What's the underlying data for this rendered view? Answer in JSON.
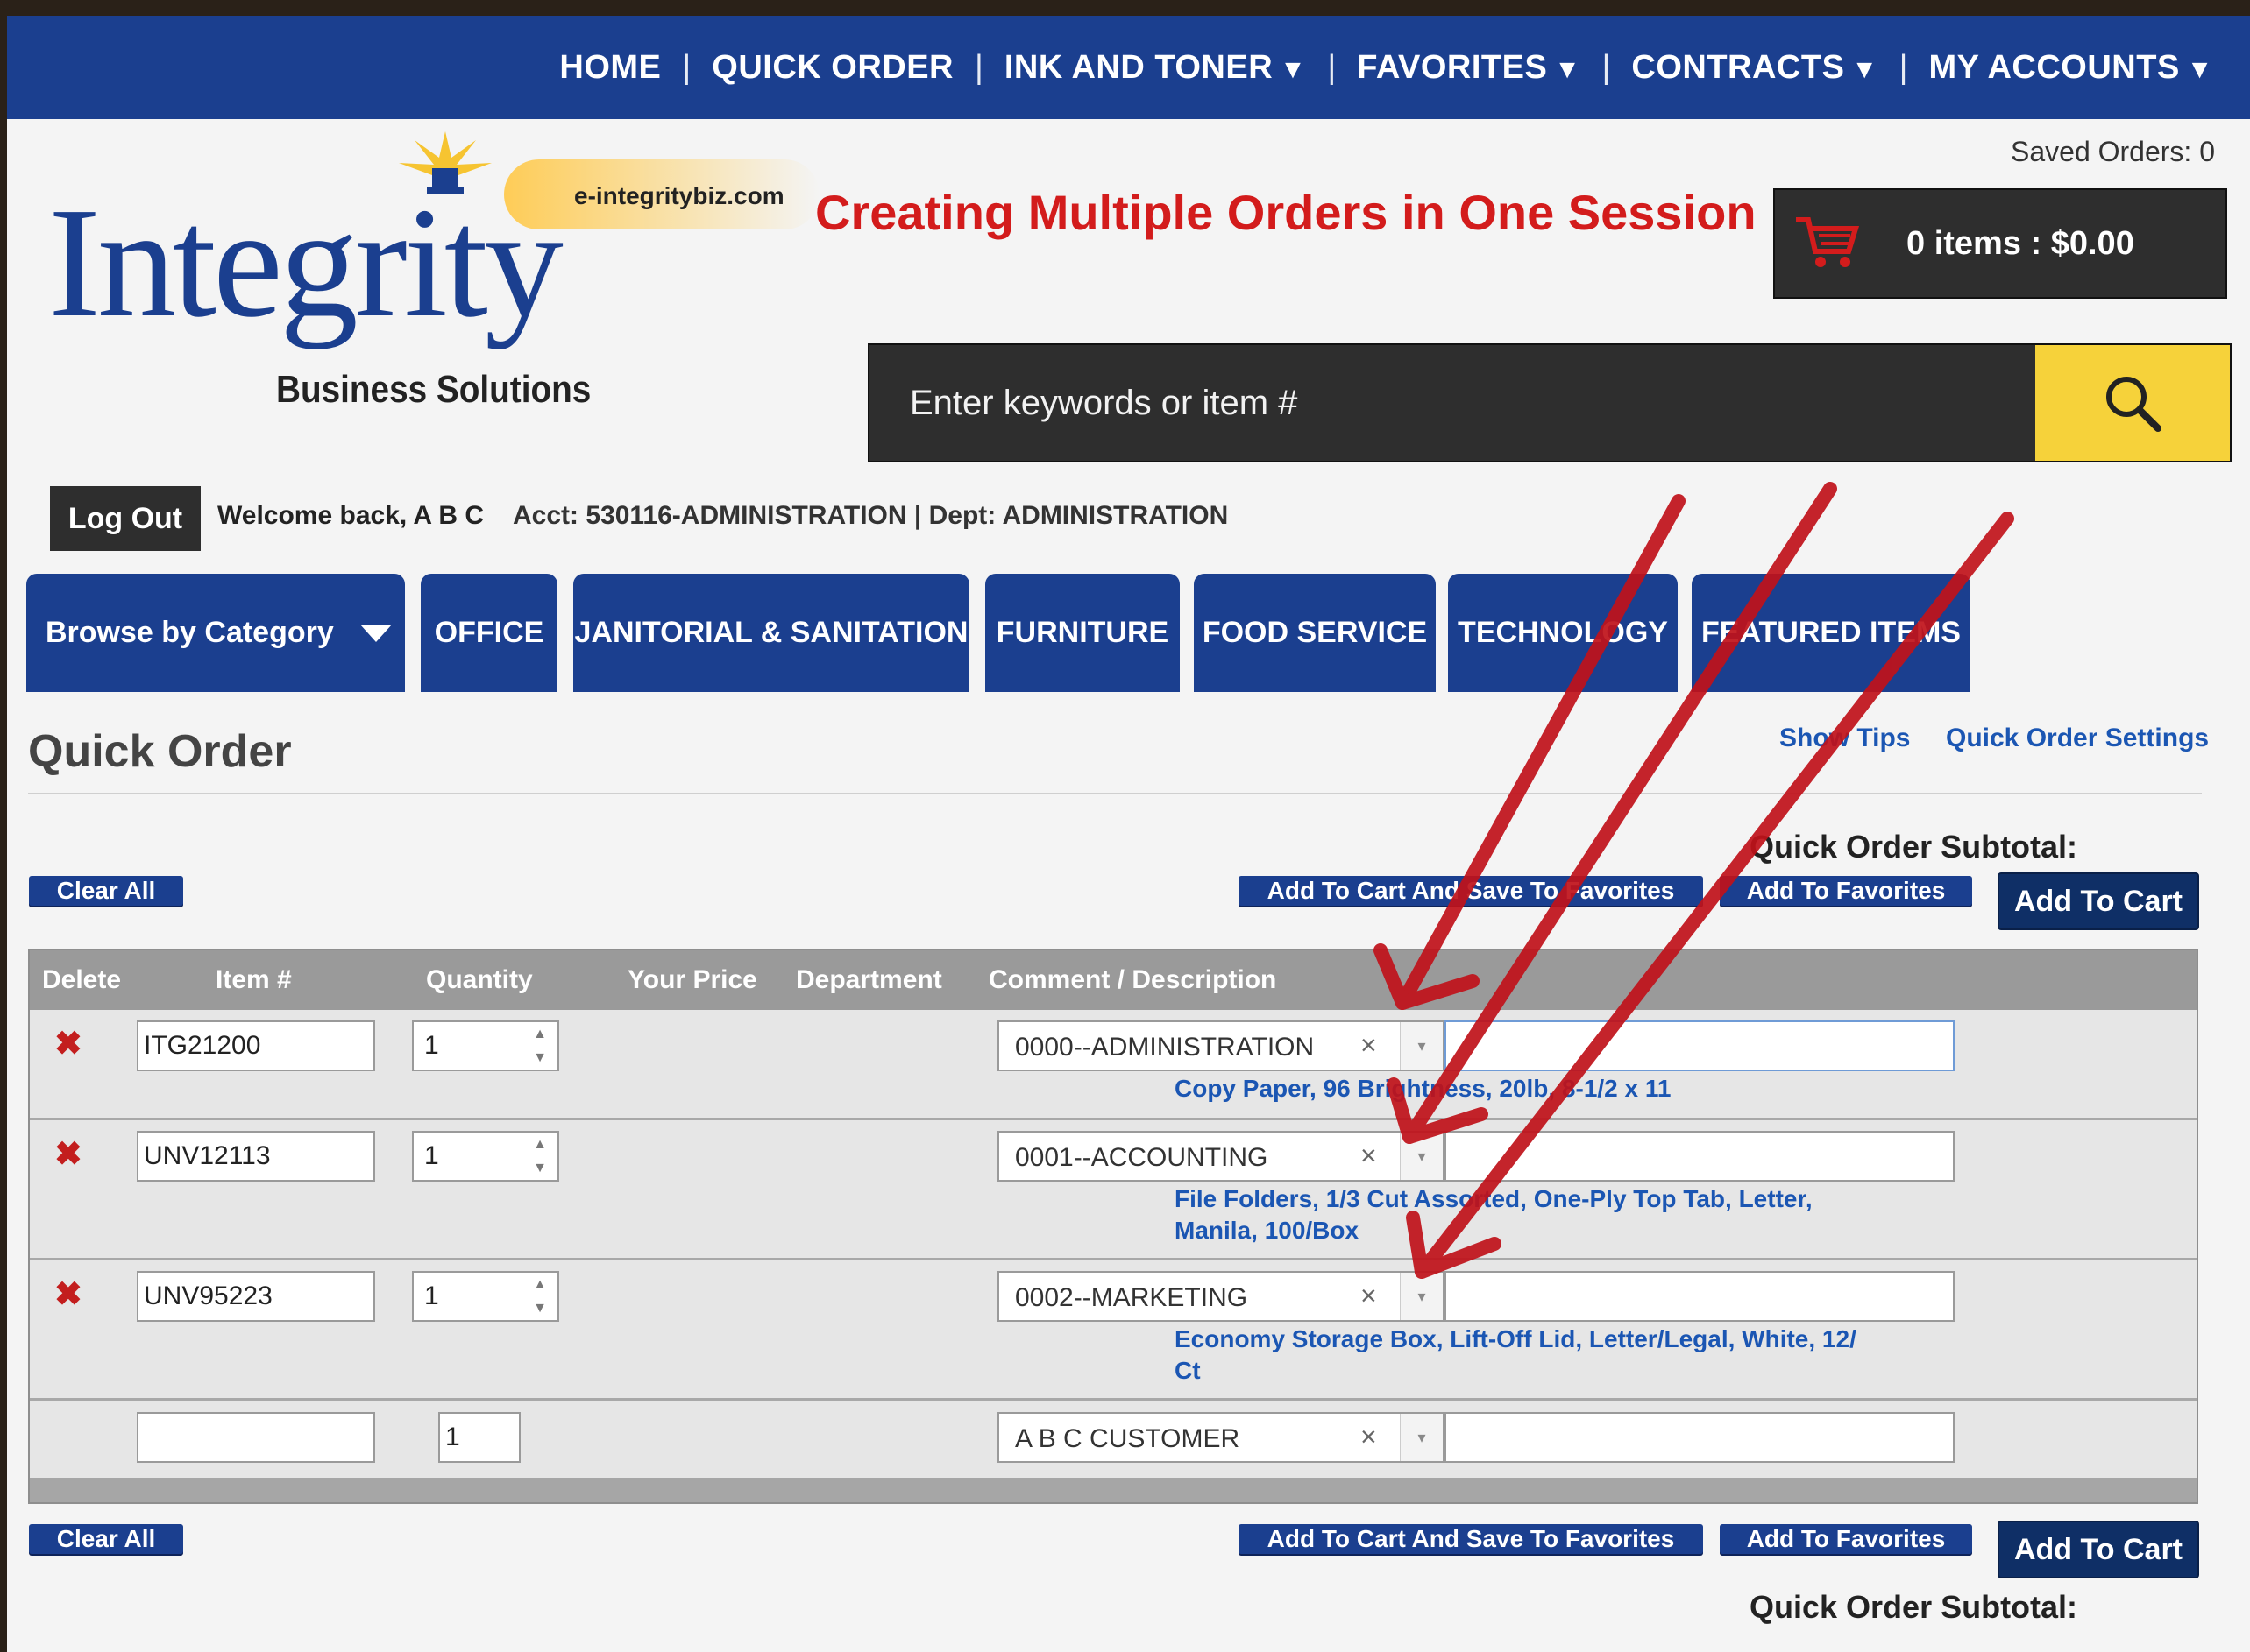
{
  "nav": {
    "items": [
      {
        "label": "HOME",
        "dropdown": false
      },
      {
        "label": "QUICK ORDER",
        "dropdown": false
      },
      {
        "label": "INK AND TONER",
        "dropdown": true
      },
      {
        "label": "FAVORITES",
        "dropdown": true
      },
      {
        "label": "CONTRACTS",
        "dropdown": true
      },
      {
        "label": "MY ACCOUNTS",
        "dropdown": true
      }
    ],
    "caret": "▼",
    "separator": "|"
  },
  "brand": {
    "name": "Integrity",
    "tagline": "Business Solutions",
    "url": "e-integritybiz.com"
  },
  "headline": "Creating Multiple Orders in One Session",
  "header": {
    "saved_orders": "Saved Orders: 0",
    "cart_summary": "0 items : $0.00",
    "cart_icon": "shopping-cart-icon",
    "cart_icon_color": "#d31c1c"
  },
  "search": {
    "placeholder": "Enter keywords or item #",
    "icon": "search-icon",
    "button_color": "#f6d23a"
  },
  "user": {
    "logout_label": "Log Out",
    "welcome": "Welcome back, A B C",
    "acct_line": "Acct: 530116-ADMINISTRATION  |  Dept: ADMINISTRATION"
  },
  "categories": {
    "browse_label": "Browse by Category",
    "items": [
      "OFFICE",
      "JANITORIAL & SANITATION",
      "FURNITURE",
      "FOOD SERVICE",
      "TECHNOLOGY",
      "FEATURED ITEMS"
    ]
  },
  "quick_order": {
    "title": "Quick Order",
    "show_tips": "Show Tips",
    "settings": "Quick Order Settings",
    "subtotal_label": "Quick Order Subtotal:",
    "clear_all": "Clear All",
    "add_cart_save_fav": "Add To Cart And Save To Favorites",
    "add_favorites": "Add To Favorites",
    "add_to_cart": "Add To Cart"
  },
  "table": {
    "headers": [
      "Delete",
      "Item #",
      "Quantity",
      "Your Price",
      "Department",
      "Comment / Description"
    ],
    "rows": [
      {
        "item": "ITG21200",
        "qty": "1",
        "dept": "0000--ADMINISTRATION",
        "desc_lines": [
          "Copy Paper, 96 Brightness, 20lb, 8-1/2 x 11"
        ]
      },
      {
        "item": "UNV12113",
        "qty": "1",
        "dept": "0001--ACCOUNTING",
        "desc_lines": [
          "File Folders, 1/3 Cut Assorted, One-Ply Top Tab, Letter,",
          "Manila, 100/Box"
        ]
      },
      {
        "item": "UNV95223",
        "qty": "1",
        "dept": "0002--MARKETING",
        "desc_lines": [
          "Economy Storage Box, Lift-Off Lid, Letter/Legal, White, 12/",
          "Ct"
        ]
      }
    ],
    "new_row": {
      "item": "",
      "qty": "1",
      "dept": "A B C CUSTOMER"
    },
    "delete_icon": "delete-x-icon",
    "clear_glyph": "×",
    "dropdown_glyph": "▾"
  },
  "colors": {
    "nav_blue": "#1b3f8f",
    "headline_red": "#d31c1c",
    "arrow_red": "#c0121a",
    "link_blue": "#1b56b3"
  }
}
